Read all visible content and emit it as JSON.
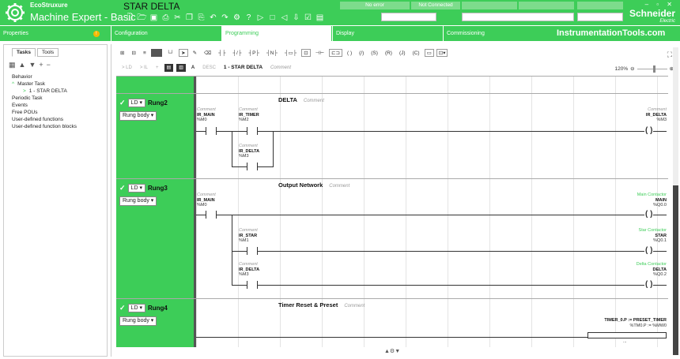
{
  "header": {
    "eco_brand": "EcoStruxure",
    "app_name": "Machine Expert - Basic",
    "project_name": "STAR DELTA",
    "status_error": "No error",
    "status_connection": "Not Connected",
    "company": "Schneider",
    "company_sub": "Electric",
    "brand_color": "#3dcd58"
  },
  "tabs": {
    "properties": "Properties",
    "properties_badge": "!",
    "configuration": "Configuration",
    "programming": "Programming",
    "display": "Display",
    "commissioning": "Commissioning",
    "site_mark": "InstrumentationTools.com"
  },
  "left": {
    "tab_tasks": "Tasks",
    "tab_tools": "Tools",
    "tree": [
      "Behavior",
      "Master Task",
      "1 - STAR DELTA",
      "Periodic Task",
      "Events",
      "Free POUs",
      "User-defined functions",
      "User-defined function blocks"
    ]
  },
  "toolbar": {
    "to_ld": "> LD",
    "to_il": "> IL",
    "add": "+",
    "desc": "DESC",
    "pou_title": "1 - STAR DELTA",
    "pou_comment": "Comment",
    "zoom": "120%"
  },
  "rungs": [
    {
      "mode": "LD",
      "name": "Rung2",
      "body": "Rung body",
      "title": "DELTA",
      "comment": "Comment",
      "elements": {
        "c1": {
          "comment": "Comment",
          "name": "IR_MAIN",
          "addr": "%M0"
        },
        "c2": {
          "comment": "Comment",
          "name": "IR_TIMER",
          "addr": "%M2"
        },
        "c3": {
          "comment": "Comment",
          "name": "IR_DELTA",
          "addr": "%M3"
        },
        "coil": {
          "comment": "Comment",
          "name": "IR_DELTA",
          "addr": "%M3"
        }
      }
    },
    {
      "mode": "LD",
      "name": "Rung3",
      "body": "Rung body",
      "title": "Output Network",
      "comment": "Comment",
      "elements": {
        "c1": {
          "comment": "Comment",
          "name": "IR_MAIN",
          "addr": "%M0"
        },
        "c2": {
          "comment": "Comment",
          "name": "IR_STAR",
          "addr": "%M1"
        },
        "c3": {
          "comment": "Comment",
          "name": "IR_DELTA",
          "addr": "%M3"
        },
        "coil1": {
          "comment": "Main Contactor",
          "name": "MAIN",
          "addr": "%Q0.0"
        },
        "coil2": {
          "comment": "Star Contactor",
          "name": "STAR",
          "addr": "%Q0.1"
        },
        "coil3": {
          "comment": "Delta Contactor",
          "name": "DELTA",
          "addr": "%Q0.2"
        }
      }
    },
    {
      "mode": "LD",
      "name": "Rung4",
      "body": "Rung body",
      "title": "Timer Reset & Preset",
      "comment": "Comment",
      "elements": {
        "assign": {
          "name": "TIMER_0.P := PRESET_TIMER",
          "addr": "%TM0.P := %MW0",
          "value": "..."
        }
      }
    }
  ]
}
